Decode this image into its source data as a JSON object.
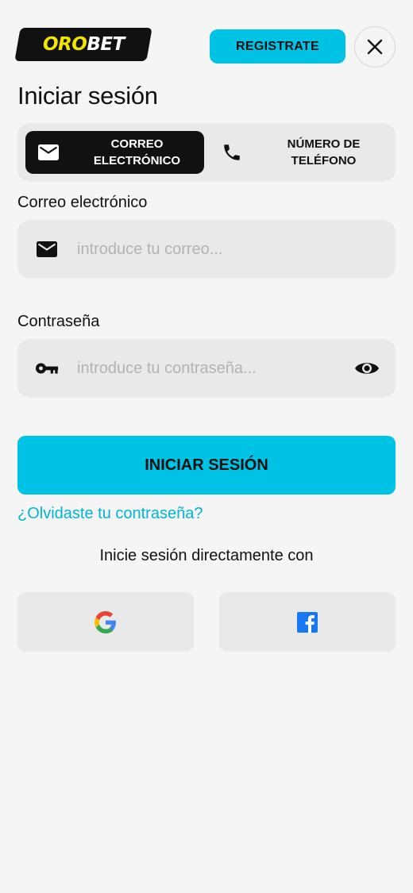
{
  "header": {
    "logo_part1": "ORO",
    "logo_part2": "BET",
    "register_label": "REGISTRATE",
    "close_icon": "close-icon"
  },
  "title": "Iniciar sesión",
  "tabs": [
    {
      "label": "CORREO\nELECTRÓNICO",
      "icon": "mail-icon",
      "active": true
    },
    {
      "label": "NÚMERO DE\nTELÉFONO",
      "icon": "phone-icon",
      "active": false
    }
  ],
  "email": {
    "label": "Correo electrónico",
    "placeholder": "introduce tu correo...",
    "value": "",
    "icon": "mail-icon"
  },
  "password": {
    "label": "Contraseña",
    "placeholder": "introduce tu contraseña...",
    "value": "",
    "icon": "key-icon",
    "toggle_icon": "eye-icon"
  },
  "login_label": "INICIAR SESIÓN",
  "forgot_label": "¿Olvidaste tu contraseña?",
  "social": {
    "caption": "Inicie sesión directamente con",
    "providers": [
      {
        "icon": "google-icon"
      },
      {
        "icon": "facebook-icon"
      }
    ]
  },
  "colors": {
    "accent": "#00c2e4",
    "link": "#00b5d6",
    "logo_yellow": "#f2e600",
    "background": "#f5f5f5",
    "field_background": "#e9e9e9",
    "dark": "#111111"
  }
}
